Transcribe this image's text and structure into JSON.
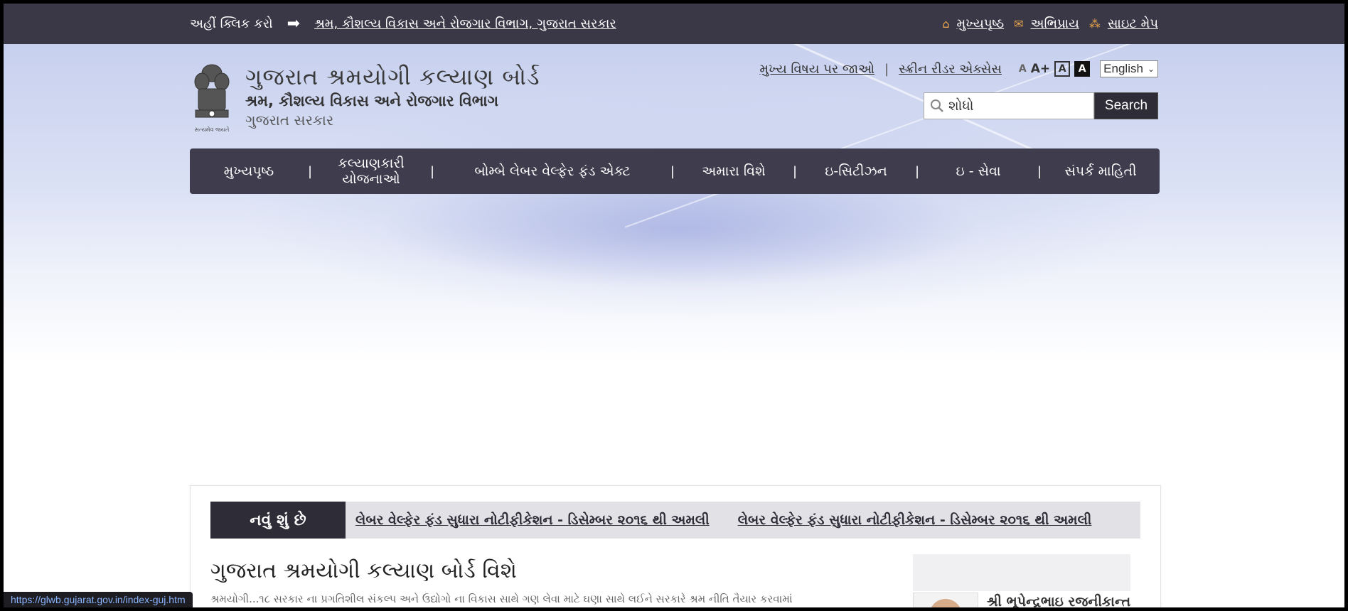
{
  "topbar": {
    "click_here": "અહીં ક્લિક કરો",
    "arrow_icon": "right-arrow",
    "dept_link": "શ્રમ, કૌશલ્ય વિકાસ અને રોજગાર વિભાગ, ગુજરાત સરકાર",
    "home": "મુખ્યપૃષ્ઠ",
    "feedback": "અભિપ્રાય",
    "sitemap": "સાઇટ મેપ"
  },
  "brand": {
    "title": "ગુજરાત શ્રમયોગી કલ્યાણ બોર્ડ",
    "subtitle": "શ્રમ, કૌશલ્ય વિકાસ અને રોજગાર વિભાગ",
    "gov": "ગુજરાત સરકાર",
    "emblem_caption": "સત્યમેવ જયતે"
  },
  "utility": {
    "skip": "મુખ્ય વિષય પર જાઓ",
    "sep": "|",
    "screen_reader": "સ્ક્રીન રીડર એક્સેસ",
    "font_small": "A",
    "font_large": "A+",
    "contrast_normal": "A",
    "contrast_dark": "A",
    "language": "English"
  },
  "search": {
    "placeholder": "શોધો",
    "button": "Search"
  },
  "nav": {
    "items": [
      "મુખ્યપૃષ્ઠ",
      "કલ્યાણકારી યોજનાઓ",
      "બોમ્બે લેબર વેલ્ફેર ફંડ એક્ટ",
      "અમારા વિશે",
      "ઇ-સિટીઝન",
      "ઇ - સેવા",
      "સંપર્ક માહિતી"
    ],
    "sep": "|"
  },
  "news": {
    "tag": "નવું શું છે",
    "items": [
      "લેબર વેલ્ફેર ફંડ સુધારા નોટીફીકેશન - ડિસેમ્બર ૨૦૧૬ થી અમલી",
      "લેબર વેલ્ફેર ફંડ સુધારા નોટીફીકેશન - ડિસેમ્બર ૨૦૧૬ થી અમલી"
    ]
  },
  "about": {
    "title": "ગુજરાત શ્રમયોગી કલ્યાણ બોર્ડ વિશે",
    "text": "શ્રમયોગી...૧૮ સરકાર ના પ્રગતિશીલ સંકલ્પ અને ઉદ્યોગો ના વિકાસ સાથે ગણ લેવા માટે ઘણા સાથે લઈને સરકારે શ્રમ નીતિ તૈયાર કરવામાં"
  },
  "person": {
    "name": "શ્રી ભૂપેન્દ્રભાઇ રજનીકાન્ત"
  },
  "status_url": "https://glwb.gujarat.gov.in/index-guj.htm"
}
